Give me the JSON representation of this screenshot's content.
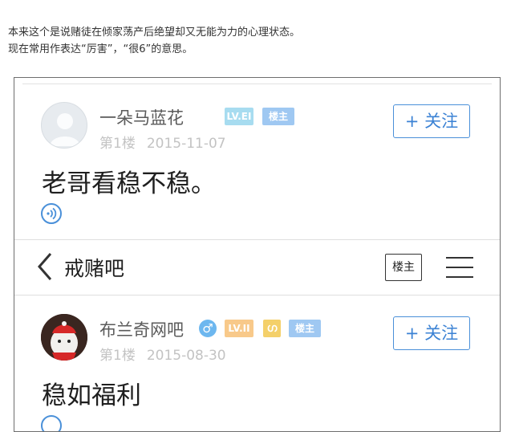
{
  "caption": {
    "line1": "本来这个是说赌徒在倾家荡产后绝望却又无能为力的心理状态。",
    "line2": "现在常用作表达“厉害”，“很6”的意思。"
  },
  "post1": {
    "username": "一朵马蓝花",
    "badge_level": "LV.EI",
    "badge_owner": "楼主",
    "floor": "第1楼",
    "date": "2015-11-07",
    "follow_label": "+ 关注",
    "content": "老哥看稳不稳。"
  },
  "nav": {
    "title": "戒赌吧",
    "owner_button": "楼主"
  },
  "post2": {
    "username": "布兰奇网吧",
    "gender_symbol": "♂",
    "badge_level": "LV.II",
    "badge_sign": "ഗ",
    "badge_owner": "楼主",
    "floor": "第1楼",
    "date": "2015-08-30",
    "follow_label": "+ 关注",
    "content": "稳如福利"
  },
  "colors": {
    "accent_blue": "#4a90d9",
    "badge_level_blue": "#a7dcf0",
    "badge_owner_blue": "#9fc8f2",
    "badge_orange": "#f8c98a",
    "badge_yellow": "#f4d06a"
  }
}
